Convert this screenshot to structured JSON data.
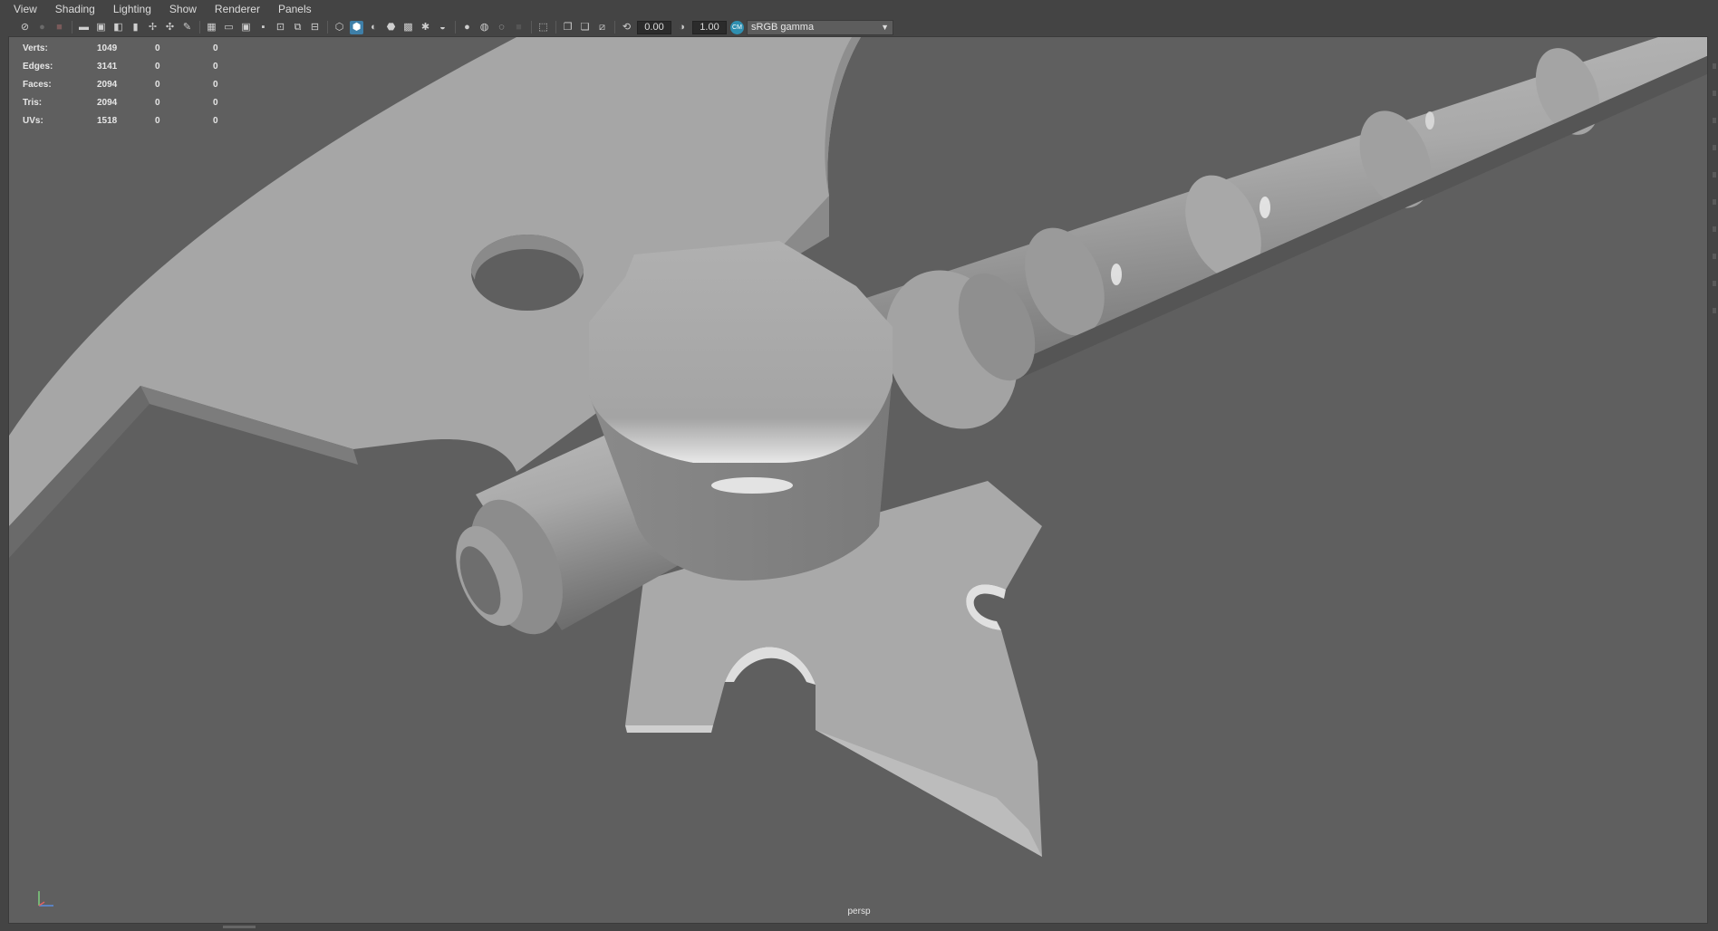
{
  "menu": {
    "items": [
      "View",
      "Shading",
      "Lighting",
      "Show",
      "Renderer",
      "Panels"
    ]
  },
  "toolbar": {
    "exposure_value": "0.00",
    "gamma_value": "1.00",
    "colorspace_badge": "CM",
    "colorspace_selected": "sRGB gamma"
  },
  "hud": {
    "rows": [
      {
        "label": "Verts:",
        "value": "1049",
        "c2": "0",
        "c3": "0"
      },
      {
        "label": "Edges:",
        "value": "3141",
        "c2": "0",
        "c3": "0"
      },
      {
        "label": "Faces:",
        "value": "2094",
        "c2": "0",
        "c3": "0"
      },
      {
        "label": "Tris:",
        "value": "2094",
        "c2": "0",
        "c3": "0"
      },
      {
        "label": "UVs:",
        "value": "1518",
        "c2": "0",
        "c3": "0"
      }
    ]
  },
  "viewport": {
    "camera": "persp",
    "background_color": "#5f5f5f",
    "model_color": "#a8a8a8",
    "selected_tool_color": "#3e7fa8"
  }
}
